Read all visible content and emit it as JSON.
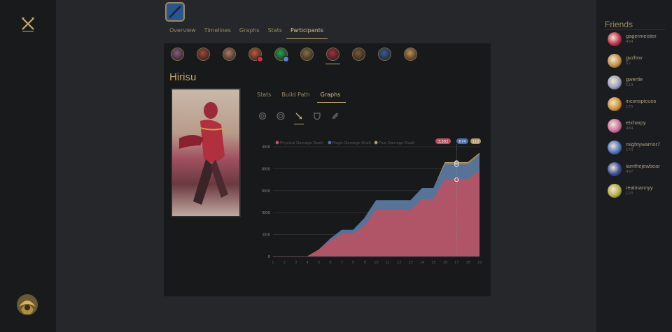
{
  "nav": {
    "tabs": [
      "Overview",
      "Timelines",
      "Graphs",
      "Stats",
      "Participants"
    ],
    "active_tab": "Participants"
  },
  "participants": [
    {
      "icon": "champion-portrait-1",
      "color": "#8a5a7a"
    },
    {
      "icon": "champion-portrait-2",
      "color": "#a04a30"
    },
    {
      "icon": "champion-portrait-3",
      "color": "#b07a6a"
    },
    {
      "icon": "champion-portrait-4",
      "color": "#c05a3a"
    },
    {
      "icon": "champion-portrait-5",
      "color": "#2aa050"
    },
    {
      "icon": "champion-portrait-6",
      "color": "#8a7040"
    },
    {
      "icon": "champion-portrait-7",
      "color": "#a03040"
    },
    {
      "icon": "champion-portrait-8",
      "color": "#7a5a30"
    },
    {
      "icon": "champion-portrait-9",
      "color": "#3a5a90"
    },
    {
      "icon": "champion-portrait-10",
      "color": "#c09050"
    }
  ],
  "player": {
    "name": "Hirisu"
  },
  "sub_tabs": [
    "Stats",
    "Build Path",
    "Graphs"
  ],
  "active_sub_tab": "Graphs",
  "stat_icons": [
    "gold-icon",
    "target-icon",
    "sword-icon",
    "shield-icon",
    "heal-icon"
  ],
  "chart_data": {
    "type": "area",
    "stacked": true,
    "x": [
      1,
      2,
      3,
      4,
      5,
      6,
      7,
      8,
      9,
      10,
      11,
      12,
      13,
      14,
      15,
      16,
      17,
      18,
      19
    ],
    "ylim": [
      0,
      5000
    ],
    "yticks": [
      0,
      1000,
      2000,
      3000,
      4000,
      5000
    ],
    "series": [
      {
        "name": "Physical Damage Dealt",
        "color": "#c0505e",
        "values": [
          0,
          0,
          0,
          0,
          300,
          700,
          1000,
          1000,
          1400,
          2100,
          2100,
          2100,
          2100,
          2600,
          2600,
          3500,
          3502,
          3502,
          3900
        ]
      },
      {
        "name": "Magic Damage Dealt",
        "color": "#4a6fa8",
        "values": [
          0,
          0,
          0,
          0,
          0,
          100,
          200,
          200,
          350,
          450,
          450,
          450,
          450,
          500,
          500,
          674,
          674,
          674,
          700
        ]
      },
      {
        "name": "True Damage Dealt",
        "color": "#b09a6a",
        "values": [
          0,
          0,
          0,
          0,
          0,
          0,
          0,
          0,
          0,
          0,
          0,
          0,
          0,
          0,
          0,
          110,
          110,
          110,
          110
        ]
      }
    ],
    "hover": {
      "x": 17,
      "labels": [
        "3,502",
        "674",
        "110"
      ]
    },
    "grid": true,
    "legend": "top-left"
  },
  "friends": {
    "title": "Friends",
    "items": [
      {
        "name": "gagermeister",
        "level": "494",
        "color": "#c0304a"
      },
      {
        "name": "gvzhnv",
        "level": "52",
        "color": "#c09040"
      },
      {
        "name": "gwertle",
        "level": "113",
        "color": "#9aa0c0"
      },
      {
        "name": "inconspicuos",
        "level": "175",
        "color": "#d09030"
      },
      {
        "name": "etxharpy",
        "level": "484",
        "color": "#d070a0"
      },
      {
        "name": "mightywarrior7",
        "level": "173",
        "color": "#5070c0"
      },
      {
        "name": "iamthejewbear",
        "level": "497",
        "color": "#3a4a9a"
      },
      {
        "name": "realmannyy",
        "level": "120",
        "color": "#b0b040"
      }
    ]
  }
}
